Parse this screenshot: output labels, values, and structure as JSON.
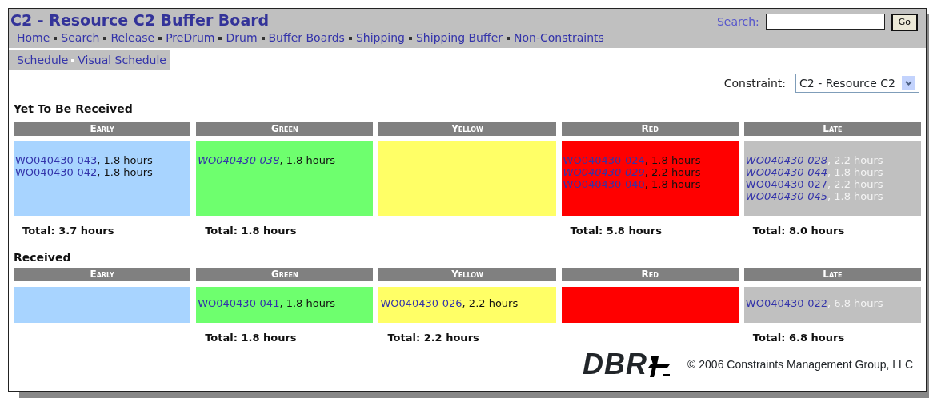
{
  "header": {
    "title": "C2 - Resource C2 Buffer Board",
    "search_label": "Search:",
    "search_button": "Go",
    "nav": [
      "Home",
      "Search",
      "Release",
      "PreDrum",
      "Drum",
      "Buffer Boards",
      "Shipping",
      "Shipping Buffer",
      "Non-Constraints"
    ],
    "subnav": [
      "Schedule",
      "Visual Schedule"
    ]
  },
  "constraint": {
    "label": "Constraint:",
    "value": "C2 - Resource C2"
  },
  "sections": [
    {
      "title": "Yet To Be Received",
      "zones": [
        {
          "name": "Early",
          "color": "#a8d4ff",
          "kind": "normal",
          "orders": [
            {
              "id": "WO040430-043",
              "hours": ", 1.8 hours",
              "italic": false
            },
            {
              "id": "WO040430-042",
              "hours": ", 1.8 hours",
              "italic": false
            }
          ],
          "total": "Total: 3.7 hours"
        },
        {
          "name": "Green",
          "color": "#6eff6e",
          "kind": "normal",
          "orders": [
            {
              "id": "WO040430-038",
              "hours": ", 1.8 hours",
              "italic": true
            }
          ],
          "total": "Total: 1.8 hours"
        },
        {
          "name": "Yellow",
          "color": "#ffff66"
        },
        {
          "name": "Red",
          "color": "#ff0000",
          "kind": "normal",
          "orders": [
            {
              "id": "WO040430-024",
              "hours": ", 1.8 hours",
              "italic": false
            },
            {
              "id": "WO040430-029",
              "hours": ", 2.2 hours",
              "italic": true
            },
            {
              "id": "WO040430-040",
              "hours": ", 1.8 hours",
              "italic": false
            }
          ],
          "total": "Total: 5.8 hours"
        },
        {
          "name": "Late",
          "color": "#c0c0c0",
          "kind": "late",
          "orders": [
            {
              "id": "WO040430-028",
              "hours": ", 2.2 hours",
              "italic": true
            },
            {
              "id": "WO040430-044",
              "hours": ", 1.8 hours",
              "italic": true
            },
            {
              "id": "WO040430-027",
              "hours": ", 2.2 hours",
              "italic": false
            },
            {
              "id": "WO040430-045",
              "hours": ", 1.8 hours",
              "italic": true
            }
          ],
          "total": "Total: 8.0 hours"
        }
      ]
    },
    {
      "title": "Received",
      "zones": [
        {
          "name": "Early",
          "color": "#a8d4ff"
        },
        {
          "name": "Green",
          "color": "#6eff6e",
          "kind": "normal",
          "orders": [
            {
              "id": "WO040430-041",
              "hours": ", 1.8 hours",
              "italic": false
            }
          ],
          "total": "Total: 1.8 hours"
        },
        {
          "name": "Yellow",
          "color": "#ffff66",
          "kind": "normal",
          "orders": [
            {
              "id": "WO040430-026",
              "hours": ", 2.2 hours",
              "italic": false
            }
          ],
          "total": "Total: 2.2 hours"
        },
        {
          "name": "Red",
          "color": "#ff0000"
        },
        {
          "name": "Late",
          "color": "#c0c0c0",
          "kind": "late",
          "orders": [
            {
              "id": "WO040430-022",
              "hours": ", 6.8 hours",
              "italic": false
            }
          ],
          "total": "Total: 6.8 hours"
        }
      ]
    }
  ],
  "footer": {
    "logo": "DBR",
    "copyright": "© 2006 Constraints Management Group, LLC"
  }
}
